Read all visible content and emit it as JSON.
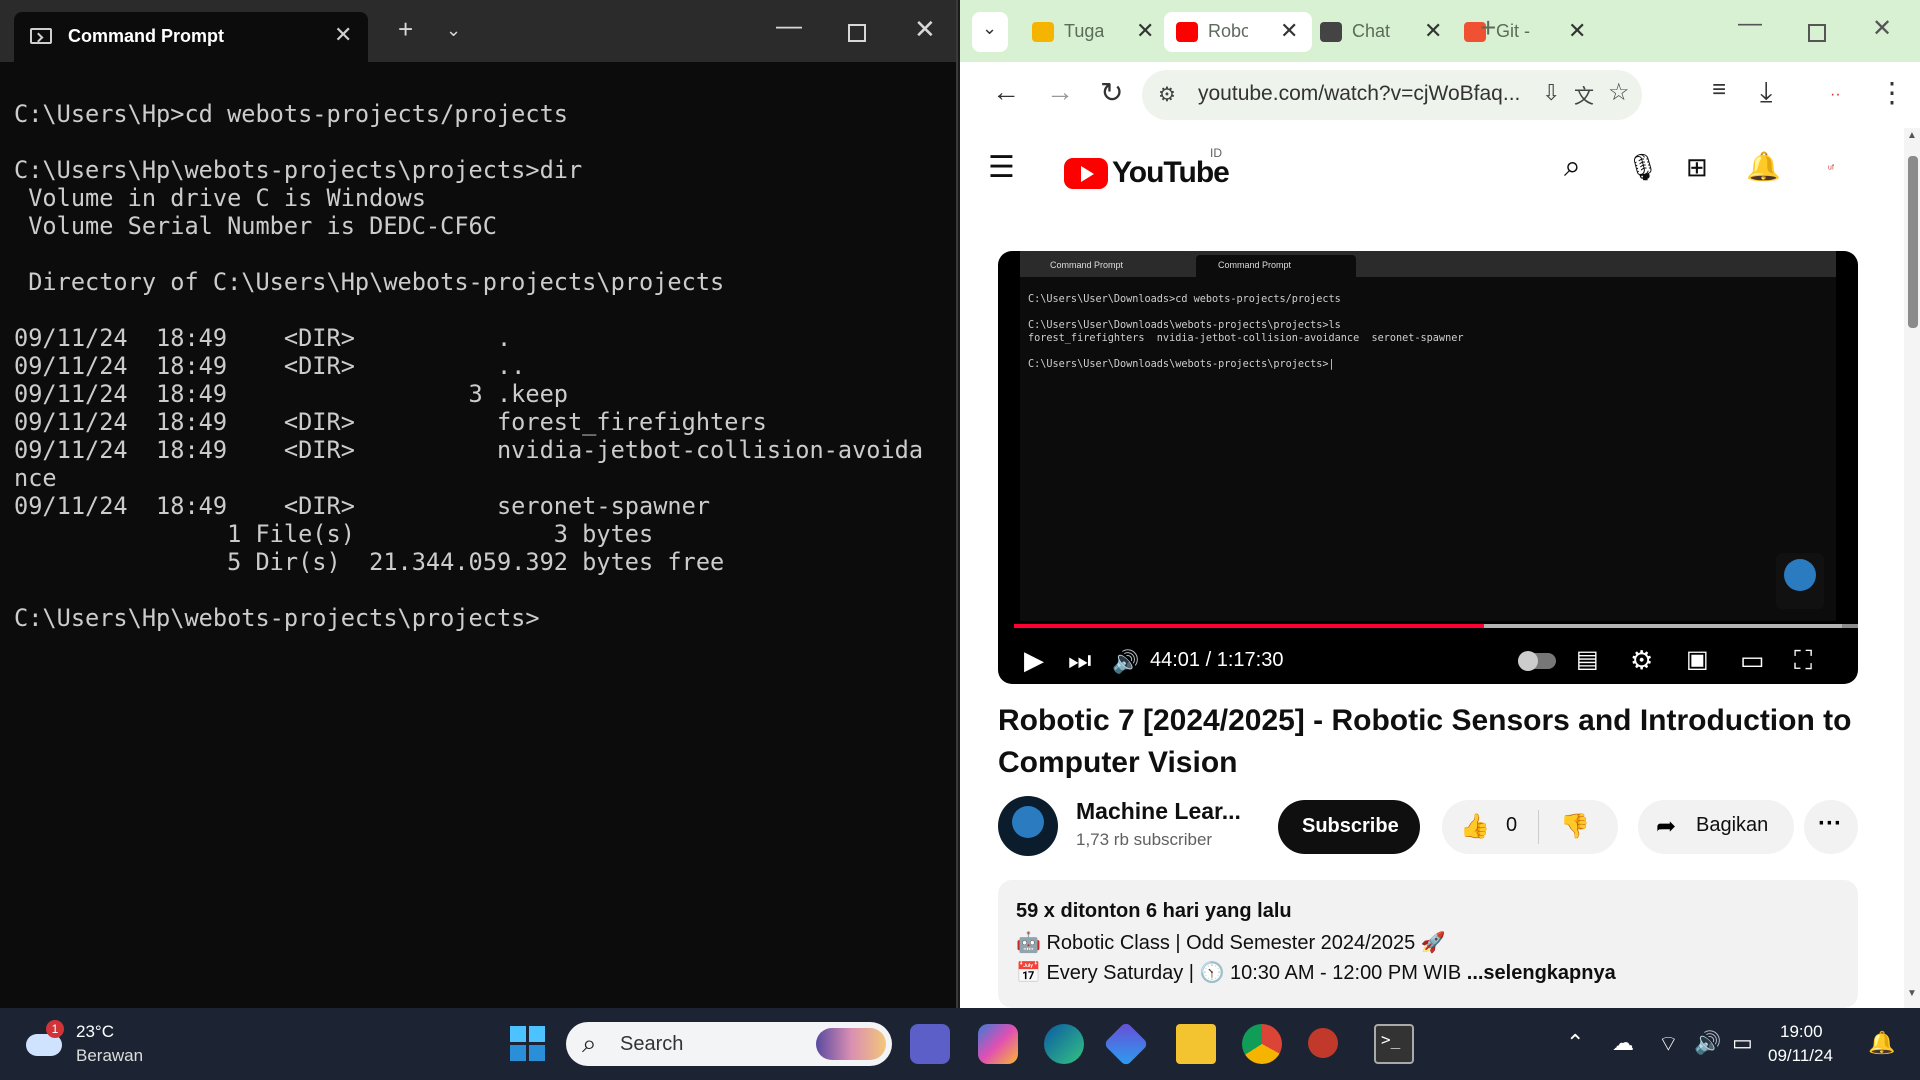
{
  "terminal": {
    "tab_title": "Command Prompt",
    "lines": [
      "C:\\Users\\Hp>cd webots-projects/projects",
      "",
      "C:\\Users\\Hp\\webots-projects\\projects>dir",
      " Volume in drive C is Windows",
      " Volume Serial Number is DEDC-CF6C",
      "",
      " Directory of C:\\Users\\Hp\\webots-projects\\projects",
      "",
      "09/11/24  18:49    <DIR>          .",
      "09/11/24  18:49    <DIR>          ..",
      "09/11/24  18:49                 3 .keep",
      "09/11/24  18:49    <DIR>          forest_firefighters",
      "09/11/24  18:49    <DIR>          nvidia-jetbot-collision-avoida",
      "nce",
      "09/11/24  18:49    <DIR>          seronet-spawner",
      "               1 File(s)              3 bytes",
      "               5 Dir(s)  21.344.059.392 bytes free",
      "",
      "C:\\Users\\Hp\\webots-projects\\projects>"
    ]
  },
  "browser": {
    "tabs": [
      {
        "label": "Tuga",
        "icon": "slides-icon",
        "color": "#f4b400",
        "active": false
      },
      {
        "label": "Robo",
        "icon": "youtube-icon",
        "color": "#ff0000",
        "active": true
      },
      {
        "label": "Chat",
        "icon": "chatgpt-icon",
        "color": "#444444",
        "active": false
      },
      {
        "label": "Git -",
        "icon": "git-icon",
        "color": "#f05133",
        "active": false
      }
    ],
    "url": "youtube.com/watch?v=cjWoBfaq...",
    "brand_color": "#d7f1d2"
  },
  "youtube": {
    "logo_text": "YouTube",
    "region": "ID",
    "player": {
      "inner_tab_1": "Command Prompt",
      "inner_tab_2": "Command Prompt",
      "inner_lines": [
        "C:\\Users\\User\\Downloads>cd webots-projects/projects",
        "",
        "C:\\Users\\User\\Downloads\\webots-projects\\projects>ls",
        "forest_firefighters  nvidia-jetbot-collision-avoidance  seronet-spawner",
        "",
        "C:\\Users\\User\\Downloads\\webots-projects\\projects>|"
      ],
      "time": "44:01 / 1:17:30",
      "progress": 0.5677,
      "buffered": 0.485
    },
    "title": "Robotic 7 [2024/2025] - Robotic Sensors and Introduction to Computer Vision",
    "channel": {
      "name": "Machine Lear...",
      "subscribers": "1,73 rb subscriber",
      "subscribe_label": "Subscribe"
    },
    "likes": "0",
    "share_label": "Bagikan",
    "description": {
      "meta": "59 x ditonton  6 hari yang lalu",
      "line1": "Robotic Class | Odd Semester 2024/2025 🚀",
      "line2_prefix": "Every Saturday | ",
      "line2_time": "10:30 AM - 12:00 PM WIB ",
      "more": "...selengkapnya"
    }
  },
  "taskbar": {
    "weather_temp": "23°C",
    "weather_desc": "Berawan",
    "weather_badge": "1",
    "search_placeholder": "Search",
    "time": "19:00",
    "date": "09/11/24"
  }
}
